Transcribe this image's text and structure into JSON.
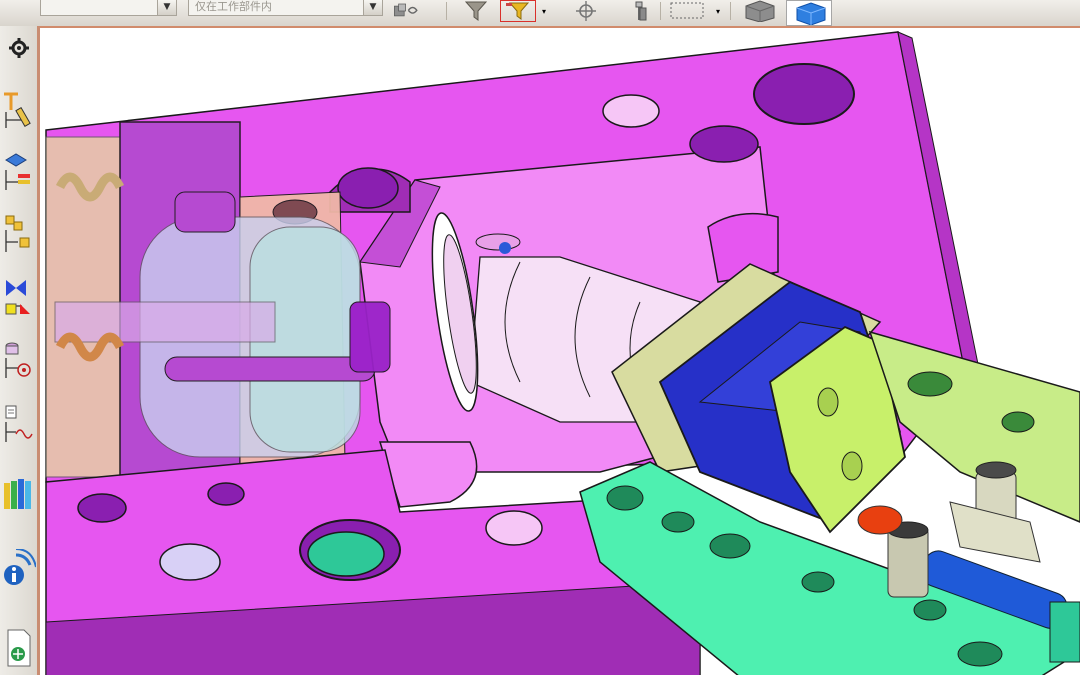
{
  "toolbar": {
    "combo_left_value": "",
    "work_part_combo_value": "仅在工作部件内",
    "colors": {
      "accent_red": "#d9302a",
      "filter_yellow": "#e8b622",
      "cube_blue": "#2f7fe0"
    },
    "icons": [
      "combo-dropdown-icon",
      "assembly-link-icon",
      "type-filter-icon",
      "selection-filter-icon",
      "snap-point-icon",
      "component-icon",
      "rectangle-select-icon",
      "view-cube-gray-icon",
      "view-cube-blue-icon"
    ]
  },
  "sidebar": {
    "items": [
      {
        "icon": "settings-gear-icon"
      },
      {
        "icon": "assembly-constraint-icon"
      },
      {
        "icon": "part-navigator-icon"
      },
      {
        "icon": "assembly-navigator-icon"
      },
      {
        "icon": "constraint-navigator-icon"
      },
      {
        "icon": "reuse-library-icon"
      },
      {
        "icon": "history-icon"
      },
      {
        "icon": "palette-icon"
      },
      {
        "icon": "info-web-icon"
      },
      {
        "icon": "document-icon"
      }
    ]
  },
  "viewport": {
    "description_colors": {
      "mold_plate": "#e84ff0",
      "plate_side": "#a02db5",
      "slider_blue": "#2630c8",
      "wedge_green": "#c8f06a",
      "clamp_plate_teal": "#4ef0b0",
      "frame_olive": "#d8f0a0"
    }
  }
}
